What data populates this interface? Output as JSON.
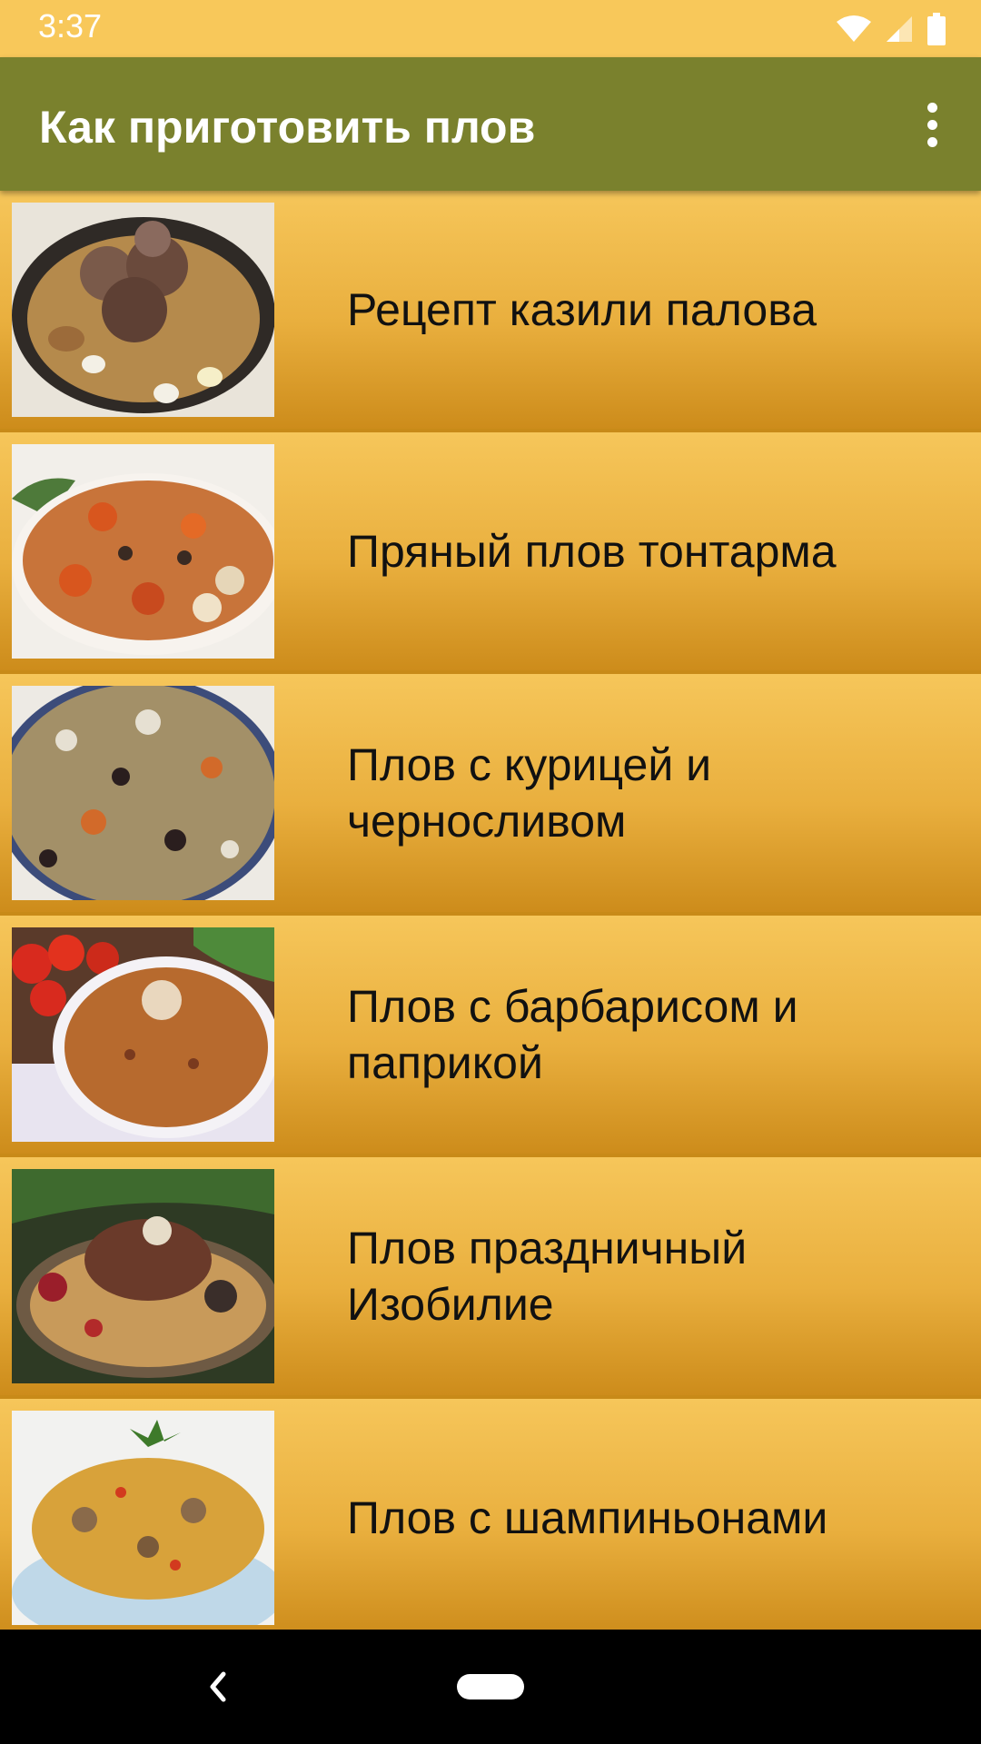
{
  "status_bar": {
    "time": "3:37",
    "icons": [
      "wifi-icon",
      "signal-icon",
      "battery-icon"
    ]
  },
  "app_bar": {
    "title": "Как приготовить плов",
    "menu_icon": "more-vert-icon"
  },
  "colors": {
    "status_bar": "#F8C85A",
    "app_bar": "#7A812D",
    "row_top": "#F6C65A",
    "row_bottom": "#CD8C1B"
  },
  "recipes": [
    {
      "title": "Рецепт казили палова"
    },
    {
      "title": "Пряный плов тонтарма"
    },
    {
      "title": "Плов с курицей и черносливом"
    },
    {
      "title": "Плов с барбарисом и паприкой"
    },
    {
      "title": "Плов праздничный Изобилие"
    },
    {
      "title": "Плов с шампиньонами"
    }
  ],
  "nav_bar": {
    "back_icon": "back-icon",
    "home_icon": "home-pill-icon"
  }
}
